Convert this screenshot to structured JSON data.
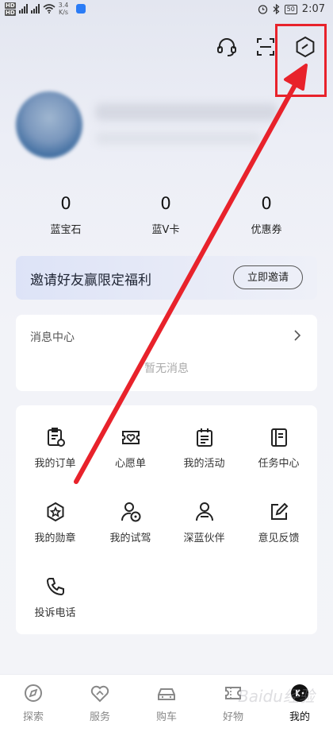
{
  "status_bar": {
    "net_speed_value": "3.4",
    "net_speed_unit": "K/s",
    "battery": "50",
    "time": "2:07"
  },
  "header": {
    "icons": [
      "headset-icon",
      "scan-icon",
      "settings-hexagon-icon"
    ]
  },
  "stats": [
    {
      "value": "0",
      "label": "蓝宝石"
    },
    {
      "value": "0",
      "label": "蓝V卡"
    },
    {
      "value": "0",
      "label": "优惠券"
    }
  ],
  "invite": {
    "text": "邀请好友赢限定福利",
    "button": "立即邀请"
  },
  "messages": {
    "title": "消息中心",
    "empty": "暂无消息"
  },
  "grid": [
    {
      "label": "我的订单",
      "icon": "order-icon"
    },
    {
      "label": "心愿单",
      "icon": "wishlist-icon"
    },
    {
      "label": "我的活动",
      "icon": "activity-icon"
    },
    {
      "label": "任务中心",
      "icon": "task-icon"
    },
    {
      "label": "我的勋章",
      "icon": "medal-icon"
    },
    {
      "label": "我的试驾",
      "icon": "test-drive-icon"
    },
    {
      "label": "深蓝伙伴",
      "icon": "partner-icon"
    },
    {
      "label": "意见反馈",
      "icon": "feedback-icon"
    },
    {
      "label": "投诉电话",
      "icon": "phone-icon"
    }
  ],
  "tabs": [
    {
      "label": "探索",
      "icon": "compass-icon"
    },
    {
      "label": "服务",
      "icon": "service-icon"
    },
    {
      "label": "购车",
      "icon": "car-icon"
    },
    {
      "label": "好物",
      "icon": "ticket-icon"
    },
    {
      "label": "我的",
      "icon": "profile-icon",
      "active": true
    }
  ],
  "watermark": "Baidu经验",
  "colors": {
    "annotation_red": "#e8222b",
    "invite_bg": "#dde3f7"
  }
}
